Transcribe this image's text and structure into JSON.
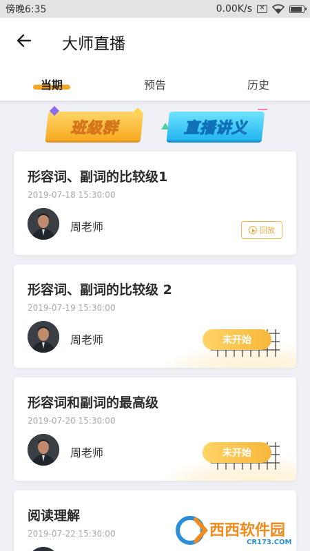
{
  "status_bar": {
    "time": "傍晚6:35",
    "network_speed": "0.00K/s",
    "x_badge": "✕"
  },
  "header": {
    "title": "大师直播",
    "back_icon": "back-arrow-icon"
  },
  "tabs": [
    {
      "label": "当期",
      "active": true
    },
    {
      "label": "预告",
      "active": false
    },
    {
      "label": "历史",
      "active": false
    }
  ],
  "banners": {
    "class_group": "班级群",
    "live_notes": "直播讲义"
  },
  "cards": [
    {
      "title": "形容词、副词的比较级1",
      "date": "2019-07-18 15:30:00",
      "teacher": "周老师",
      "action": "回放"
    },
    {
      "title": "形容词、副词的比较级 2",
      "date": "2019-07-19 15:30:00",
      "teacher": "周老师",
      "status": "未开始"
    },
    {
      "title": "形容词和副词的最高级",
      "date": "2019-07-20 15:30:00",
      "teacher": "周老师",
      "status": "未开始"
    },
    {
      "title": "阅读理解",
      "date": "2019-07-22 15:30:00"
    }
  ],
  "watermark": {
    "name": "西西软件园",
    "domain": "CR173.COM"
  },
  "colors": {
    "accent": "#f6a623",
    "status_pill": "#f6b73c",
    "background": "#eef0f5"
  }
}
